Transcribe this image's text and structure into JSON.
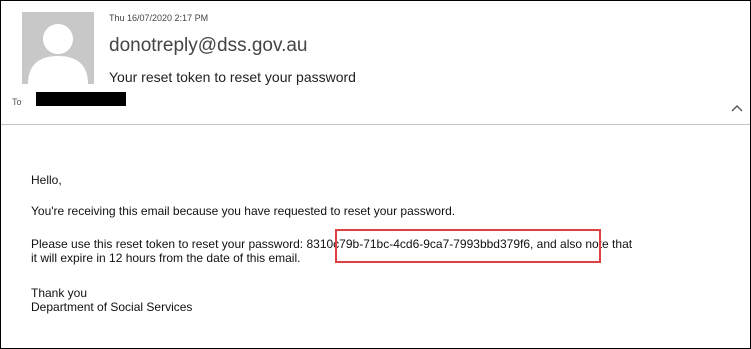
{
  "email": {
    "timestamp": "Thu 16/07/2020 2:17 PM",
    "sender": "donotreply@dss.gov.au",
    "subject": "Your reset token to reset your password",
    "to_label": "To"
  },
  "body": {
    "greeting": "Hello,",
    "receiving": "You're receiving this email because you have requested to reset your password.",
    "use_token_before": "Please use this reset token to reset your password:",
    "token": "8310c79b-71bc-4cd6-9ca7-7993bbd379f6",
    "use_token_after": ", and also note that",
    "use_token_line2": "it will expire in 12 hours from the date of this email.",
    "thanks": "Thank you",
    "signature": "Department of Social Services"
  },
  "colors": {
    "highlight_border": "#e04040",
    "avatar_bg": "#c8c8c8"
  },
  "icons": {
    "avatar": "person-silhouette-icon",
    "collapse": "chevron-up-icon"
  }
}
